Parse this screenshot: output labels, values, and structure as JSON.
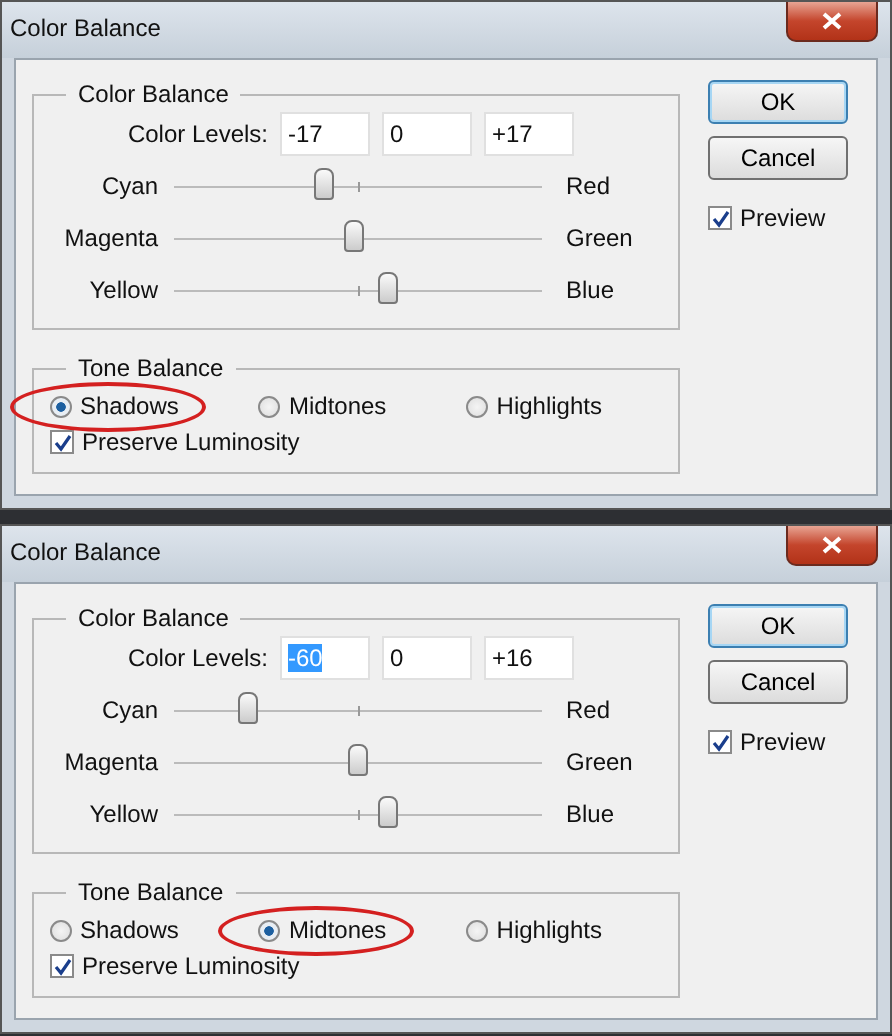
{
  "dialogs": [
    {
      "title": "Color Balance",
      "group_title": "Color Balance",
      "levels_label": "Color Levels:",
      "levels": [
        {
          "value": "-17",
          "selected": false
        },
        {
          "value": "0",
          "selected": false
        },
        {
          "value": "+17",
          "selected": false
        }
      ],
      "sliders": [
        {
          "left": "Cyan",
          "right": "Red",
          "level": 0.41
        },
        {
          "left": "Magenta",
          "right": "Green",
          "level": 0.49
        },
        {
          "left": "Yellow",
          "right": "Blue",
          "level": 0.58
        }
      ],
      "tone_title": "Tone Balance",
      "tone_options": [
        {
          "label": "Shadows",
          "selected": true,
          "circled": true
        },
        {
          "label": "Midtones",
          "selected": false,
          "circled": false
        },
        {
          "label": "Highlights",
          "selected": false,
          "circled": false
        }
      ],
      "preserve": {
        "label": "Preserve Luminosity",
        "checked": true
      },
      "buttons": [
        {
          "label": "OK",
          "default": true
        },
        {
          "label": "Cancel",
          "default": false
        }
      ],
      "preview": {
        "label": "Preview",
        "checked": true
      }
    },
    {
      "title": "Color Balance",
      "group_title": "Color Balance",
      "levels_label": "Color Levels:",
      "levels": [
        {
          "value": "-60",
          "selected": true
        },
        {
          "value": "0",
          "selected": false
        },
        {
          "value": "+16",
          "selected": false
        }
      ],
      "sliders": [
        {
          "left": "Cyan",
          "right": "Red",
          "level": 0.2
        },
        {
          "left": "Magenta",
          "right": "Green",
          "level": 0.5
        },
        {
          "left": "Yellow",
          "right": "Blue",
          "level": 0.58
        }
      ],
      "tone_title": "Tone Balance",
      "tone_options": [
        {
          "label": "Shadows",
          "selected": false,
          "circled": false
        },
        {
          "label": "Midtones",
          "selected": true,
          "circled": true
        },
        {
          "label": "Highlights",
          "selected": false,
          "circled": false
        }
      ],
      "preserve": {
        "label": "Preserve Luminosity",
        "checked": true
      },
      "buttons": [
        {
          "label": "OK",
          "default": true
        },
        {
          "label": "Cancel",
          "default": false
        }
      ],
      "preview": {
        "label": "Preview",
        "checked": true
      }
    }
  ]
}
